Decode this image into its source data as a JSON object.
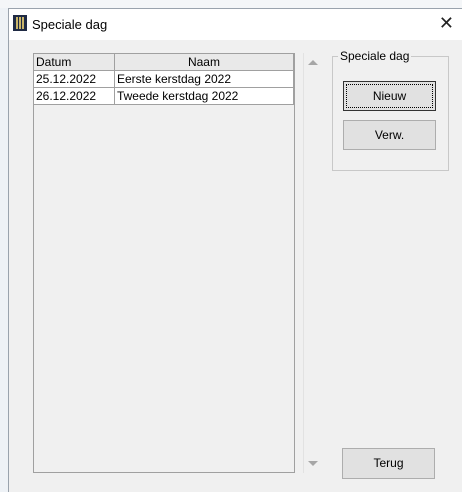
{
  "window": {
    "title": "Speciale dag",
    "close_glyph": "✕"
  },
  "grid": {
    "columns": [
      "Datum",
      "Naam"
    ],
    "rows": [
      {
        "datum": "25.12.2022",
        "naam": "Eerste kerstdag 2022"
      },
      {
        "datum": "26.12.2022",
        "naam": "Tweede kerstdag 2022"
      }
    ]
  },
  "group": {
    "label": "Speciale dag",
    "new_label": "Nieuw",
    "delete_label": "Verw."
  },
  "footer": {
    "back_label": "Terug"
  },
  "icons": {
    "app": "app-icon",
    "close": "close-icon",
    "scroll_up": "chevron-up-icon",
    "scroll_down": "chevron-down-icon"
  },
  "colors": {
    "app_icon_dark": "#1f2a44",
    "app_icon_accent": "#c9b56a"
  }
}
